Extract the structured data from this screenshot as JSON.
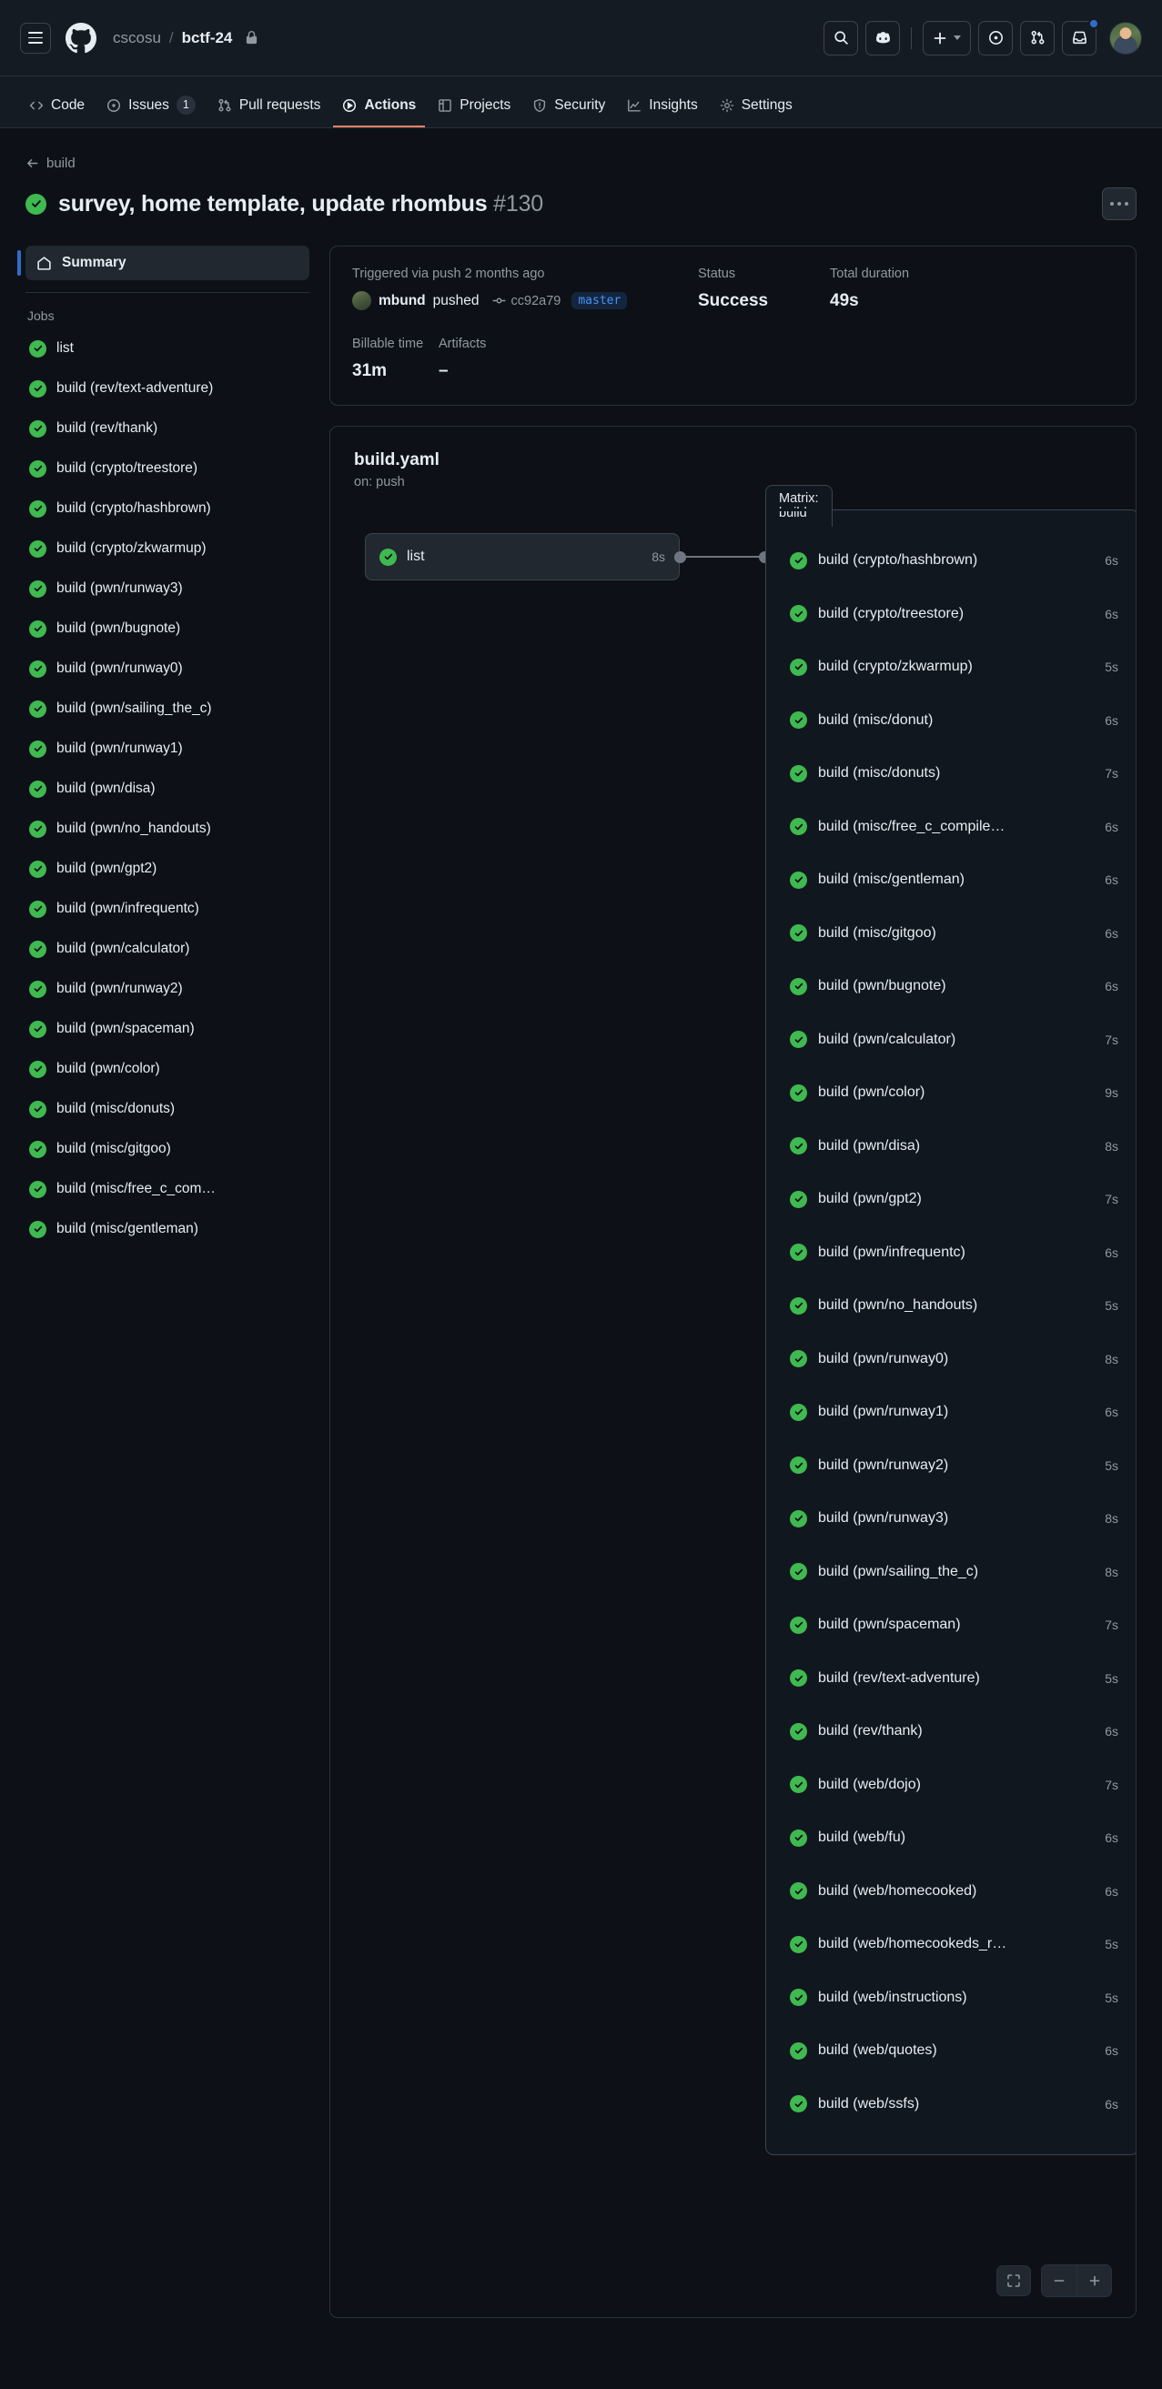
{
  "header": {
    "owner": "cscosu",
    "separator": "/",
    "repo": "bctf-24",
    "icons": {
      "menu": "hamburger-icon",
      "logo": "github-logo-icon",
      "lock": "lock-icon",
      "search": "search-icon",
      "copilot": "copilot-icon",
      "plus": "plus-icon",
      "issues": "issue-opened-icon",
      "pulls": "git-pull-request-icon",
      "inbox": "inbox-icon",
      "avatar": "user-avatar"
    }
  },
  "repo_nav": {
    "items": [
      {
        "label": "Code",
        "icon": "code-icon",
        "count": "",
        "active": false
      },
      {
        "label": "Issues",
        "icon": "issue-opened-icon",
        "count": "1",
        "active": false
      },
      {
        "label": "Pull requests",
        "icon": "git-pull-request-icon",
        "count": "",
        "active": false
      },
      {
        "label": "Actions",
        "icon": "play-icon",
        "count": "",
        "active": true
      },
      {
        "label": "Projects",
        "icon": "table-icon",
        "count": "",
        "active": false
      },
      {
        "label": "Security",
        "icon": "shield-icon",
        "count": "",
        "active": false
      },
      {
        "label": "Insights",
        "icon": "graph-icon",
        "count": "",
        "active": false
      },
      {
        "label": "Settings",
        "icon": "gear-icon",
        "count": "",
        "active": false
      }
    ]
  },
  "page": {
    "back_label": "build",
    "title": "survey, home template, update rhombus",
    "run_number": "#130",
    "status_icon": "check-circle-icon",
    "kebab_label": "..."
  },
  "summary": {
    "trigger_label": "Triggered via push 2 months ago",
    "actor": "mbund",
    "action_word": "pushed",
    "commit_sha": "cc92a79",
    "branch": "master",
    "status_label": "Status",
    "status_value": "Success",
    "duration_label": "Total duration",
    "duration_value": "49s",
    "billable_label": "Billable time",
    "billable_value": "31m",
    "artifacts_label": "Artifacts",
    "artifacts_value": "–"
  },
  "sidebar": {
    "summary_label": "Summary",
    "summary_icon": "home-icon",
    "jobs_label": "Jobs",
    "jobs": [
      {
        "name": "list",
        "status": "success"
      },
      {
        "name": "build (rev/text-adventure)",
        "status": "success"
      },
      {
        "name": "build (rev/thank)",
        "status": "success"
      },
      {
        "name": "build (crypto/treestore)",
        "status": "success"
      },
      {
        "name": "build (crypto/hashbrown)",
        "status": "success"
      },
      {
        "name": "build (crypto/zkwarmup)",
        "status": "success"
      },
      {
        "name": "build (pwn/runway3)",
        "status": "success"
      },
      {
        "name": "build (pwn/bugnote)",
        "status": "success"
      },
      {
        "name": "build (pwn/runway0)",
        "status": "success"
      },
      {
        "name": "build (pwn/sailing_the_c)",
        "status": "success"
      },
      {
        "name": "build (pwn/runway1)",
        "status": "success"
      },
      {
        "name": "build (pwn/disa)",
        "status": "success"
      },
      {
        "name": "build (pwn/no_handouts)",
        "status": "success"
      },
      {
        "name": "build (pwn/gpt2)",
        "status": "success"
      },
      {
        "name": "build (pwn/infrequentc)",
        "status": "success"
      },
      {
        "name": "build (pwn/calculator)",
        "status": "success"
      },
      {
        "name": "build (pwn/runway2)",
        "status": "success"
      },
      {
        "name": "build (pwn/spaceman)",
        "status": "success"
      },
      {
        "name": "build (pwn/color)",
        "status": "success"
      },
      {
        "name": "build (misc/donuts)",
        "status": "success"
      },
      {
        "name": "build (misc/gitgoo)",
        "status": "success"
      },
      {
        "name": "build (misc/free_c_com…",
        "status": "success"
      },
      {
        "name": "build (misc/gentleman)",
        "status": "success"
      }
    ]
  },
  "graph": {
    "workflow_file": "build.yaml",
    "trigger": "on: push",
    "start_node": {
      "name": "list",
      "duration": "8s",
      "status": "success"
    },
    "matrix_tab_label": "Matrix: build",
    "matrix_jobs": [
      {
        "name": "build (crypto/hashbrown)",
        "duration": "6s",
        "status": "success"
      },
      {
        "name": "build (crypto/treestore)",
        "duration": "6s",
        "status": "success"
      },
      {
        "name": "build (crypto/zkwarmup)",
        "duration": "5s",
        "status": "success"
      },
      {
        "name": "build (misc/donut)",
        "duration": "6s",
        "status": "success"
      },
      {
        "name": "build (misc/donuts)",
        "duration": "7s",
        "status": "success"
      },
      {
        "name": "build (misc/free_c_compile…",
        "duration": "6s",
        "status": "success"
      },
      {
        "name": "build (misc/gentleman)",
        "duration": "6s",
        "status": "success"
      },
      {
        "name": "build (misc/gitgoo)",
        "duration": "6s",
        "status": "success"
      },
      {
        "name": "build (pwn/bugnote)",
        "duration": "6s",
        "status": "success"
      },
      {
        "name": "build (pwn/calculator)",
        "duration": "7s",
        "status": "success"
      },
      {
        "name": "build (pwn/color)",
        "duration": "9s",
        "status": "success"
      },
      {
        "name": "build (pwn/disa)",
        "duration": "8s",
        "status": "success"
      },
      {
        "name": "build (pwn/gpt2)",
        "duration": "7s",
        "status": "success"
      },
      {
        "name": "build (pwn/infrequentc)",
        "duration": "6s",
        "status": "success"
      },
      {
        "name": "build (pwn/no_handouts)",
        "duration": "5s",
        "status": "success"
      },
      {
        "name": "build (pwn/runway0)",
        "duration": "8s",
        "status": "success"
      },
      {
        "name": "build (pwn/runway1)",
        "duration": "6s",
        "status": "success"
      },
      {
        "name": "build (pwn/runway2)",
        "duration": "5s",
        "status": "success"
      },
      {
        "name": "build (pwn/runway3)",
        "duration": "8s",
        "status": "success"
      },
      {
        "name": "build (pwn/sailing_the_c)",
        "duration": "8s",
        "status": "success"
      },
      {
        "name": "build (pwn/spaceman)",
        "duration": "7s",
        "status": "success"
      },
      {
        "name": "build (rev/text-adventure)",
        "duration": "5s",
        "status": "success"
      },
      {
        "name": "build (rev/thank)",
        "duration": "6s",
        "status": "success"
      },
      {
        "name": "build (web/dojo)",
        "duration": "7s",
        "status": "success"
      },
      {
        "name": "build (web/fu)",
        "duration": "6s",
        "status": "success"
      },
      {
        "name": "build (web/homecooked)",
        "duration": "6s",
        "status": "success"
      },
      {
        "name": "build (web/homecookeds_r…",
        "duration": "5s",
        "status": "success"
      },
      {
        "name": "build (web/instructions)",
        "duration": "5s",
        "status": "success"
      },
      {
        "name": "build (web/quotes)",
        "duration": "6s",
        "status": "success"
      },
      {
        "name": "build (web/ssfs)",
        "duration": "6s",
        "status": "success"
      }
    ],
    "controls": {
      "fit_icon": "fit-screen-icon",
      "zoom_out_icon": "minus-icon",
      "zoom_in_icon": "plus-icon"
    }
  },
  "colors": {
    "page_bg": "#0d1117",
    "header_bg": "#151b23",
    "border": "#2a313c",
    "success_green": "#3fb950",
    "accent_blue": "#316dca",
    "link_blue": "#4493f8",
    "active_tab": "#f78166",
    "muted_text": "#9198a1"
  }
}
